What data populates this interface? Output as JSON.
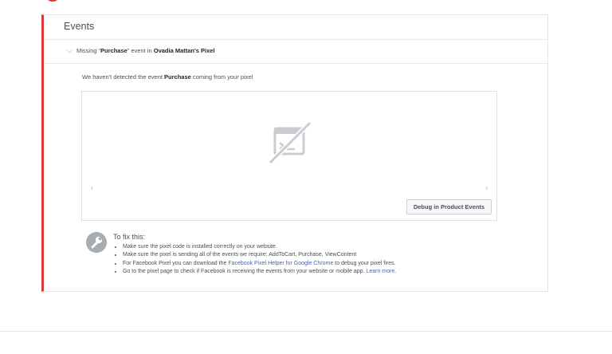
{
  "events": {
    "title": "Events",
    "section": {
      "prefix": "Missing “",
      "event_name": "Purchase",
      "middle": "” event in ",
      "pixel_name": "Ovadia Mattan's Pixel"
    },
    "notice": {
      "prefix": "We haven't detected the event ",
      "event_name": "Purchase",
      "suffix": " coming from your pixel"
    },
    "preview": {
      "left_arrow": "‹",
      "right_arrow": "›",
      "debug_button": "Debug in Product Events"
    },
    "fix": {
      "title": "To fix this:",
      "items": {
        "i0": "Make sure the pixel code is installed correctly on your website.",
        "i1": "Make sure the pixel is sending all of the events we require: AddToCart, Purchase, ViewContent",
        "i2_before": "For Facebook Pixel you can download the ",
        "i2_link": "Facebook Pixel Helper for Google Chrome",
        "i2_after": " to debug your pixel fires.",
        "i3_before": "Go to the pixel page to check if Facebook is receiving the events from your website or mobile app. ",
        "i3_link": "Learn more."
      }
    }
  },
  "colors": {
    "accent_red": "#d93838",
    "link_blue": "#4267b2",
    "icon_gray": "#a7abb2"
  },
  "icons": {
    "chevron": "chevron-down-icon",
    "placeholder": "image-placeholder-icon",
    "wrench": "wrench-icon"
  }
}
